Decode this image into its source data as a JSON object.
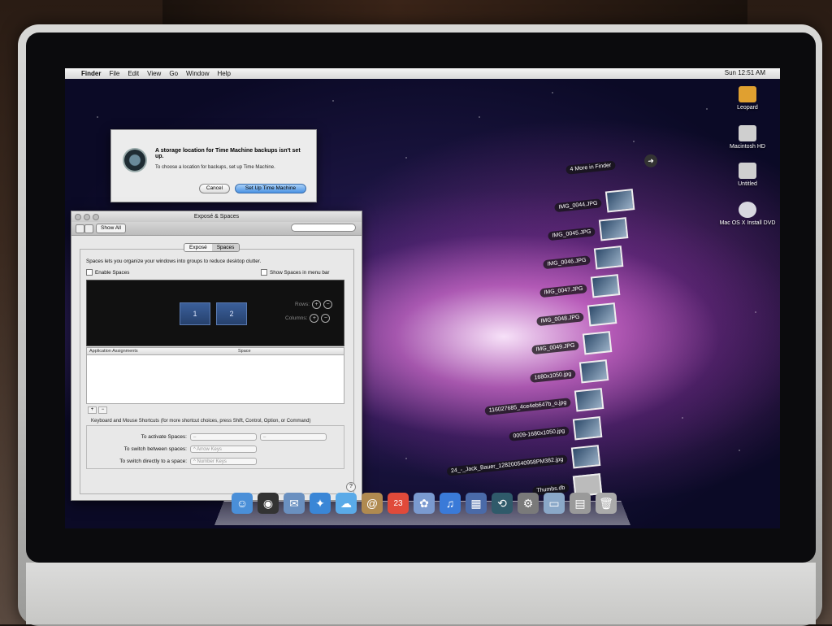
{
  "menubar": {
    "app": "Finder",
    "items": [
      "File",
      "Edit",
      "View",
      "Go",
      "Window",
      "Help"
    ],
    "clock": "Sun 12:51 AM"
  },
  "desktop_icons": [
    {
      "label": "Leopard",
      "icon": "usb-drive-icon",
      "color": "#e0a030"
    },
    {
      "label": "Macintosh HD",
      "icon": "hard-drive-icon",
      "color": "#cfcfcf"
    },
    {
      "label": "Untitled",
      "icon": "hard-drive-icon",
      "color": "#cfcfcf"
    },
    {
      "label": "Mac OS X Install DVD",
      "icon": "dvd-icon",
      "color": "#d8d8e0"
    }
  ],
  "stack": {
    "more": "4 More in Finder",
    "files": [
      "IMG_0044.JPG",
      "IMG_0045.JPG",
      "IMG_0046.JPG",
      "IMG_0047.JPG",
      "IMG_0048.JPG",
      "IMG_0049.JPG",
      "1680x1050.jpg",
      "116027685_4ce4eb647b_o.jpg",
      "0009-1680x1050.jpg",
      "24_-_Jack_Bauer_128200540958PM382.jpg",
      "Thumbs.db"
    ]
  },
  "alert": {
    "title": "A storage location for Time Machine backups isn't set up.",
    "message": "To choose a location for backups, set up Time Machine.",
    "cancel": "Cancel",
    "confirm": "Set Up Time Machine"
  },
  "prefs": {
    "title": "Exposé & Spaces",
    "show_all": "Show All",
    "tabs": [
      "Exposé",
      "Spaces"
    ],
    "description": "Spaces lets you organize your windows into groups to reduce desktop clutter.",
    "enable_spaces": "Enable Spaces",
    "show_in_menubar": "Show Spaces in menu bar",
    "space_tiles": [
      "1",
      "2"
    ],
    "rows_label": "Rows:",
    "columns_label": "Columns:",
    "table_headers": [
      "Application Assignments",
      "Space"
    ],
    "shortcuts_title": "Keyboard and Mouse Shortcuts (for more shortcut choices, press Shift, Control, Option, or Command)",
    "shortcuts": [
      {
        "label": "To activate Spaces:",
        "value": "–",
        "value2": "–"
      },
      {
        "label": "To switch between spaces:",
        "value": "^ Arrow Keys"
      },
      {
        "label": "To switch directly to a space:",
        "value": "^ Number Keys"
      }
    ],
    "help": "?"
  },
  "dock": [
    {
      "name": "finder-icon",
      "glyph": "☺",
      "color": "#4a8fd8"
    },
    {
      "name": "dashboard-icon",
      "glyph": "◉",
      "color": "#333"
    },
    {
      "name": "mail-icon",
      "glyph": "✉",
      "color": "#6a90c0"
    },
    {
      "name": "safari-icon",
      "glyph": "✦",
      "color": "#3a86d6"
    },
    {
      "name": "ichat-icon",
      "glyph": "☁",
      "color": "#5aaae8"
    },
    {
      "name": "address-book-icon",
      "glyph": "@",
      "color": "#b08a50"
    },
    {
      "name": "ical-icon",
      "glyph": "23",
      "color": "#e04a3a"
    },
    {
      "name": "preview-icon",
      "glyph": "✿",
      "color": "#7a9ad0"
    },
    {
      "name": "itunes-icon",
      "glyph": "♫",
      "color": "#3a7ad8"
    },
    {
      "name": "spaces-icon",
      "glyph": "▦",
      "color": "#4a6aa8"
    },
    {
      "name": "time-machine-icon",
      "glyph": "⟲",
      "color": "#2f5a6a"
    },
    {
      "name": "system-preferences-icon",
      "glyph": "⚙",
      "color": "#7a7a7a"
    },
    {
      "name": "applications-folder-icon",
      "glyph": "▭",
      "color": "#8aa8c8"
    },
    {
      "name": "documents-stack-icon",
      "glyph": "▤",
      "color": "#9a9a9a"
    },
    {
      "name": "trash-icon",
      "glyph": "🗑",
      "color": "#aaa"
    }
  ]
}
